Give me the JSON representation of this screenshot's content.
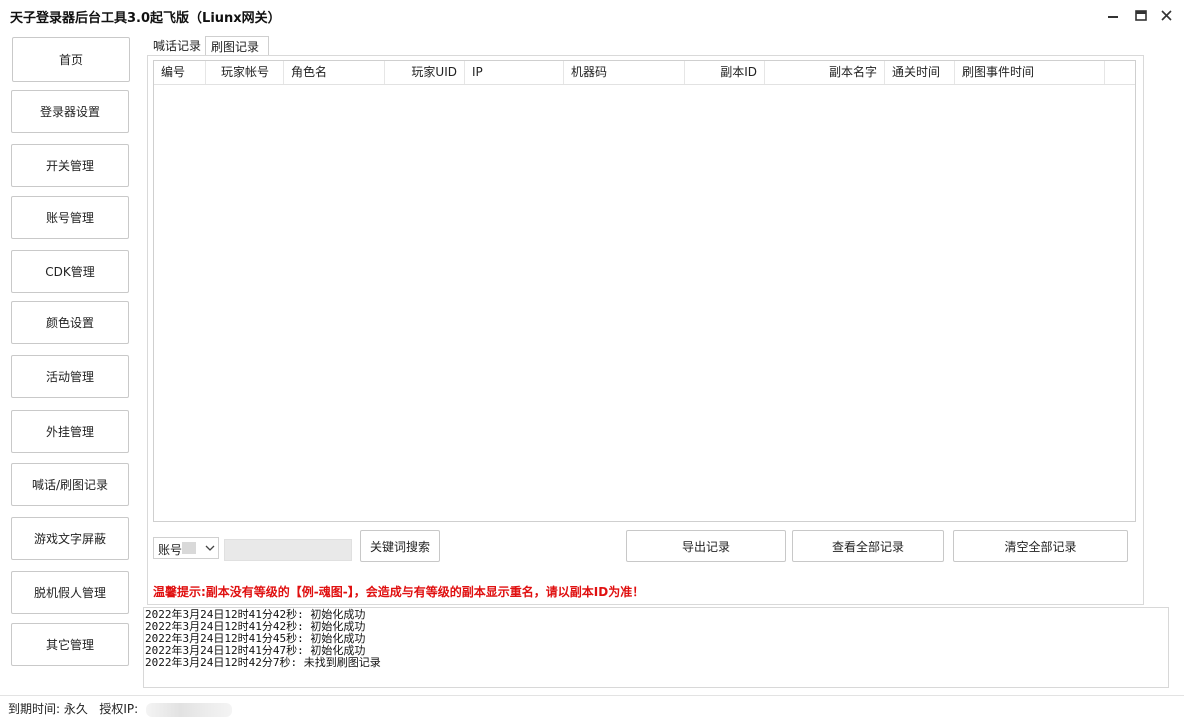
{
  "window": {
    "title": "天子登录器后台工具3.0起飞版（Liunx网关）"
  },
  "sidebar": {
    "items": [
      {
        "label": "首页"
      },
      {
        "label": "登录器设置"
      },
      {
        "label": "开关管理"
      },
      {
        "label": "账号管理"
      },
      {
        "label": "CDK管理"
      },
      {
        "label": "颜色设置"
      },
      {
        "label": "活动管理"
      },
      {
        "label": "外挂管理"
      },
      {
        "label": "喊话/刷图记录"
      },
      {
        "label": "游戏文字屏蔽"
      },
      {
        "label": "脱机假人管理"
      },
      {
        "label": "其它管理"
      }
    ]
  },
  "tabs": [
    {
      "label": "喊话记录",
      "selected": false
    },
    {
      "label": "刷图记录",
      "selected": true
    }
  ],
  "table": {
    "columns": [
      "编号",
      "玩家帐号",
      "角色名",
      "玩家UID",
      "IP",
      "机器码",
      "副本ID",
      "副本名字",
      "通关时间",
      "刷图事件时间"
    ],
    "rows": []
  },
  "search": {
    "field_selected": "账号",
    "keyword_value": "",
    "search_button": "关键词搜索"
  },
  "actions": {
    "export": "导出记录",
    "view_all": "查看全部记录",
    "clear_all": "清空全部记录"
  },
  "tip": "温馨提示:副本没有等级的【例-魂图-】，会造成与有等级的副本显示重名，请以副本ID为准！",
  "log": [
    "2022年3月24日12时41分42秒: 初始化成功",
    "2022年3月24日12时41分42秒: 初始化成功",
    "2022年3月24日12时41分45秒: 初始化成功",
    "2022年3月24日12时41分47秒: 初始化成功",
    "2022年3月24日12时42分7秒: 未找到刷图记录"
  ],
  "status": {
    "expiry_label": "到期时间:",
    "expiry_value": "永久",
    "ip_label": "授权IP:"
  }
}
